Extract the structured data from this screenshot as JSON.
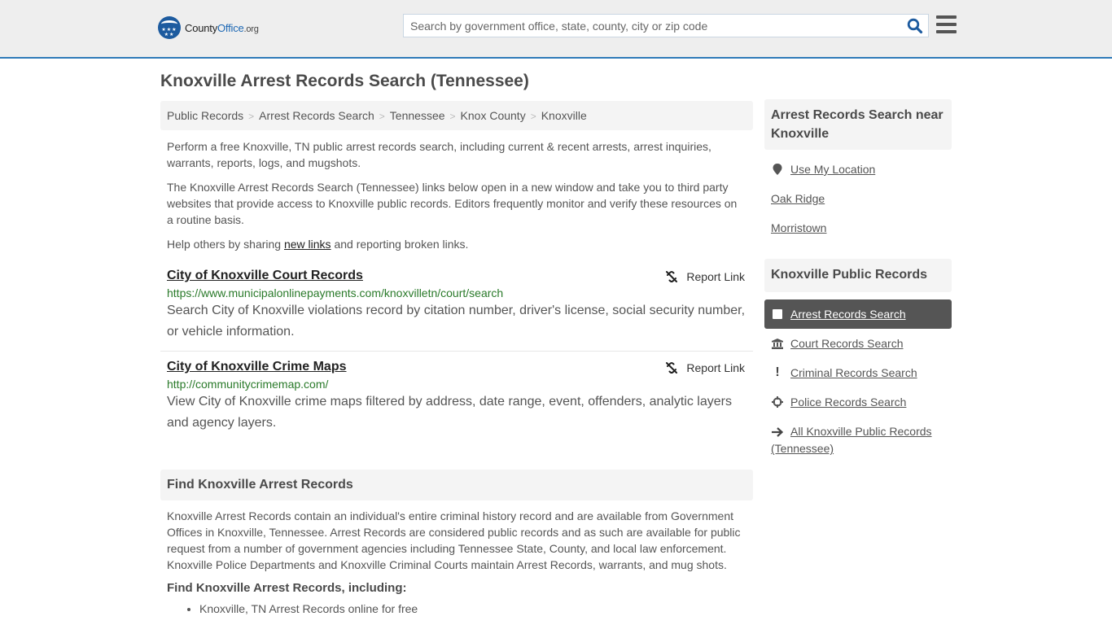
{
  "header": {
    "logo": {
      "county": "County",
      "office": "Office",
      "org": ".org"
    },
    "search": {
      "placeholder": "Search by government office, state, county, city or zip code",
      "value": ""
    }
  },
  "page_title": "Knoxville Arrest Records Search (Tennessee)",
  "breadcrumb": [
    "Public Records",
    "Arrest Records Search",
    "Tennessee",
    "Knox County",
    "Knoxville"
  ],
  "intro": {
    "p1": "Perform a free Knoxville, TN public arrest records search, including current & recent arrests, arrest inquiries, warrants, reports, logs, and mugshots.",
    "p2": "The Knoxville Arrest Records Search (Tennessee) links below open in a new window and take you to third party websites that provide access to Knoxville public records. Editors frequently monitor and verify these resources on a routine basis.",
    "p3_before": "Help others by sharing ",
    "p3_link": "new links",
    "p3_after": " and reporting broken links."
  },
  "results": [
    {
      "title": "City of Knoxville Court Records",
      "url": "https://www.municipalonlinepayments.com/knoxvilletn/court/search",
      "description": "Search City of Knoxville violations record by citation number, driver's license, social security number, or vehicle information.",
      "report_label": "Report Link"
    },
    {
      "title": "City of Knoxville Crime Maps",
      "url": "http://communitycrimemap.com/",
      "description": "View City of Knoxville crime maps filtered by address, date range, event, offenders, analytic layers and agency layers.",
      "report_label": "Report Link"
    }
  ],
  "find_section": {
    "heading": "Find Knoxville Arrest Records",
    "body": "Knoxville Arrest Records contain an individual's entire criminal history record and are available from Government Offices in Knoxville, Tennessee. Arrest Records are considered public records and as such are available for public request from a number of government agencies including Tennessee State, County, and local law enforcement. Knoxville Police Departments and Knoxville Criminal Courts maintain Arrest Records, warrants, and mug shots.",
    "subheading": "Find Knoxville Arrest Records, including:",
    "items": [
      "Knoxville, TN Arrest Records online for free"
    ]
  },
  "sidebar": {
    "nearby": {
      "heading": "Arrest Records Search near Knoxville",
      "use_location": "Use My Location",
      "places": [
        "Oak Ridge",
        "Morristown"
      ]
    },
    "public_records": {
      "heading": "Knoxville Public Records",
      "items": [
        {
          "label": "Arrest Records Search",
          "icon": "square-icon",
          "active": true
        },
        {
          "label": "Court Records Search",
          "icon": "courthouse-icon",
          "active": false
        },
        {
          "label": "Criminal Records Search",
          "icon": "exclamation-icon",
          "active": false
        },
        {
          "label": "Police Records Search",
          "icon": "crosshair-icon",
          "active": false
        },
        {
          "label": "All Knoxville Public Records (Tennessee)",
          "icon": "arrow-right-icon",
          "active": false
        }
      ]
    }
  },
  "colors": {
    "header_bg": "#eeeeee",
    "header_border": "#2f7ab8",
    "brand_blue": "#1d68b4",
    "url_green": "#2a7a2a",
    "active_nav_bg": "#555555"
  }
}
